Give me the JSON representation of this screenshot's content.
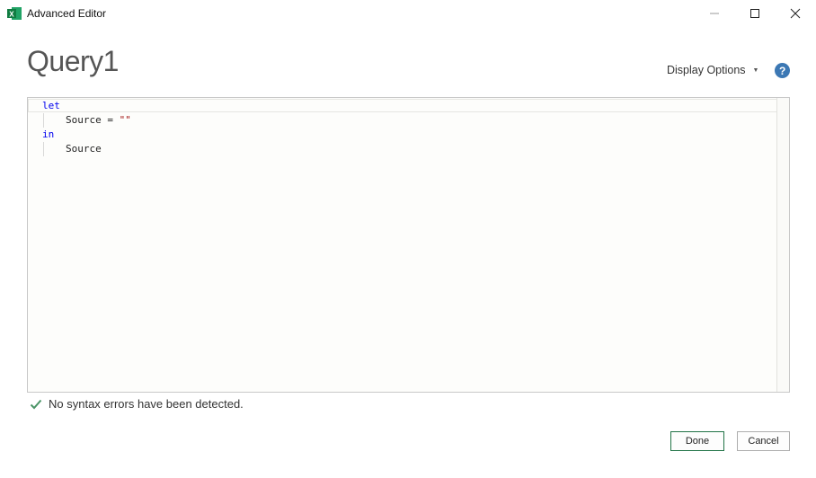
{
  "window": {
    "title": "Advanced Editor",
    "app_icon": "excel-icon",
    "controls": [
      "minimize-icon",
      "maximize-icon",
      "close-icon"
    ]
  },
  "query": {
    "name": "Query1"
  },
  "toolbar": {
    "display_options_label": "Display Options",
    "help_icon": "help-icon"
  },
  "editor": {
    "lines": [
      {
        "kw": "let"
      },
      {
        "text": "Source = ",
        "str": "\"\""
      },
      {
        "kw": "in"
      },
      {
        "text": "Source"
      }
    ]
  },
  "status": {
    "message": "No syntax errors have been detected.",
    "icon": "checkmark-icon"
  },
  "buttons": {
    "done": "Done",
    "cancel": "Cancel"
  },
  "colors": {
    "keyword": "#0000ee",
    "string": "#a31515",
    "accent": "#217346",
    "help": "#3c78b4",
    "check": "#4a9466"
  }
}
